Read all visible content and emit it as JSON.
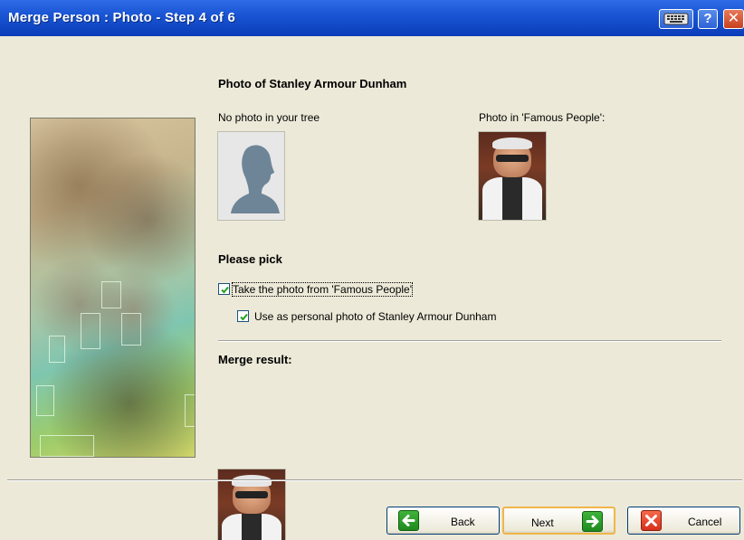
{
  "window": {
    "title": "Merge Person : Photo - Step 4 of 6",
    "help_label": "?",
    "close_label": "✕"
  },
  "photo_section": {
    "heading": "Photo of Stanley Armour Dunham",
    "left_label": "No photo in your tree",
    "right_label": "Photo in 'Famous People':"
  },
  "pick_section": {
    "heading": "Please pick",
    "option1": {
      "label": "Take the photo from 'Famous People'",
      "checked": true
    },
    "option2": {
      "label": "Use as personal photo of Stanley Armour Dunham",
      "checked": true
    }
  },
  "result_section": {
    "heading": "Merge result:"
  },
  "buttons": {
    "back": "Back",
    "next": "Next",
    "cancel": "Cancel"
  },
  "colors": {
    "accent_blue": "#0A3CB8",
    "green_icon": "#1f8a1f",
    "red_icon": "#d8301b"
  }
}
